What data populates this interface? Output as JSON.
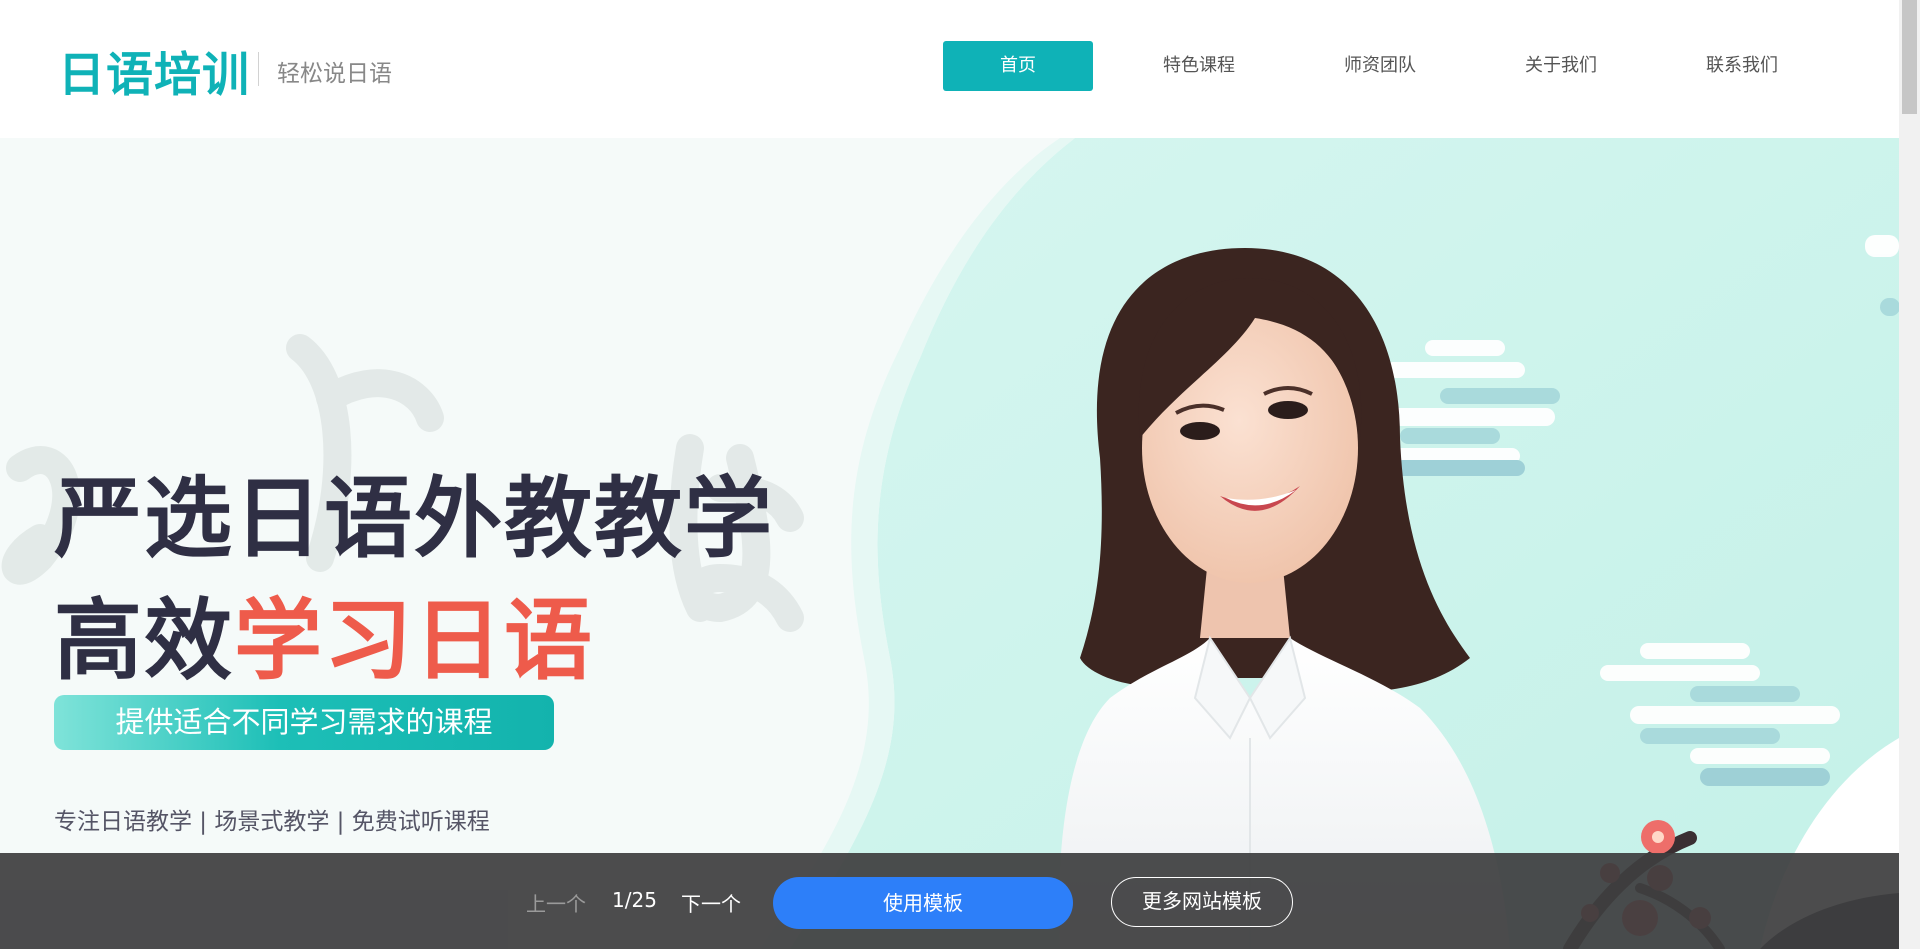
{
  "header": {
    "brand": "日语培训",
    "tagline": "轻松说日语",
    "nav": [
      {
        "label": "首页",
        "active": true
      },
      {
        "label": "特色课程",
        "active": false
      },
      {
        "label": "师资团队",
        "active": false
      },
      {
        "label": "关于我们",
        "active": false
      },
      {
        "label": "联系我们",
        "active": false
      }
    ]
  },
  "hero": {
    "title_line1": "严选日语外教教学",
    "title_line2_prefix": "高效",
    "title_line2_accent": "学习日语",
    "pill_text": "提供适合不同学习需求的课程",
    "features": "专注日语教学 | 场景式教学 | 免费试听课程",
    "image": "smiling-teacher-photo"
  },
  "bottom_bar": {
    "prev_label": "上一个",
    "page_indicator": "1/25",
    "next_label": "下一个",
    "use_template_label": "使用模板",
    "more_templates_label": "更多网站模板"
  },
  "colors": {
    "brand": "#0fb2b7",
    "accent": "#ee5b4b",
    "title": "#2f2f44",
    "primary_button": "#2d7ff9",
    "bottom_bar": "#3e3e40"
  }
}
